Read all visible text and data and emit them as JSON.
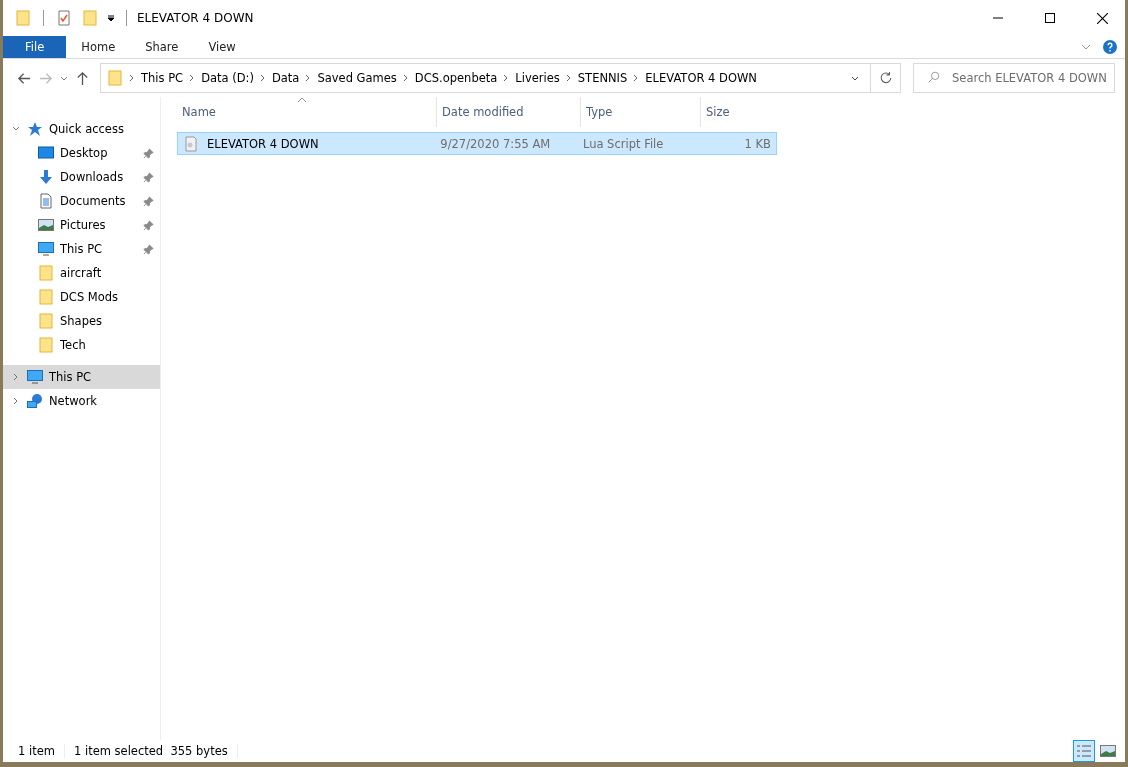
{
  "window": {
    "title": "ELEVATOR 4 DOWN"
  },
  "ribbon_tabs": [
    {
      "label": "File",
      "selected": true
    },
    {
      "label": "Home",
      "selected": false
    },
    {
      "label": "Share",
      "selected": false
    },
    {
      "label": "View",
      "selected": false
    }
  ],
  "breadcrumb": [
    "This PC",
    "Data (D:)",
    "Data",
    "Saved Games",
    "DCS.openbeta",
    "Liveries",
    "STENNIS",
    "ELEVATOR 4 DOWN"
  ],
  "search": {
    "placeholder": "Search ELEVATOR 4 DOWN"
  },
  "nav": [
    {
      "label": "Quick access",
      "kind": "star",
      "expanded": true,
      "selected": false,
      "children": [
        {
          "label": "Desktop",
          "kind": "desktop",
          "pinned": true
        },
        {
          "label": "Downloads",
          "kind": "download",
          "pinned": true
        },
        {
          "label": "Documents",
          "kind": "document",
          "pinned": true
        },
        {
          "label": "Pictures",
          "kind": "picture",
          "pinned": true
        },
        {
          "label": "This PC",
          "kind": "pc",
          "pinned": true
        },
        {
          "label": "aircraft",
          "kind": "folder",
          "pinned": false
        },
        {
          "label": "DCS Mods",
          "kind": "folder",
          "pinned": false
        },
        {
          "label": "Shapes",
          "kind": "folder",
          "pinned": false
        },
        {
          "label": "Tech",
          "kind": "folder",
          "pinned": false
        }
      ]
    },
    {
      "label": "This PC",
      "kind": "pc",
      "expanded": false,
      "selected": true
    },
    {
      "label": "Network",
      "kind": "network",
      "expanded": false,
      "selected": false
    }
  ],
  "table": {
    "columns": [
      "Name",
      "Date modified",
      "Type",
      "Size"
    ],
    "rows": [
      {
        "name": "ELEVATOR 4 DOWN",
        "date": "9/27/2020 7:55 AM",
        "type": "Lua Script File",
        "size": "1 KB",
        "selected": true
      }
    ]
  },
  "status_bar": {
    "count": "1 item",
    "selection": "1 item selected  355 bytes"
  },
  "views": [
    {
      "kind": "details",
      "selected": true
    },
    {
      "kind": "large",
      "selected": false
    }
  ]
}
